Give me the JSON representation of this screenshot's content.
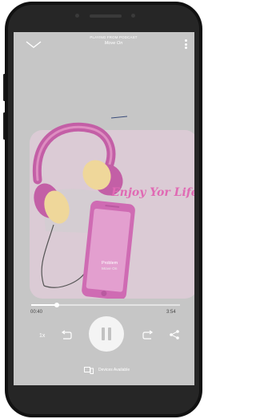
{
  "player": {
    "header_label": "PLAYING FROM PODCAST",
    "header_title": "Move On",
    "brand_text": "Enjoy Yor Life",
    "episode_title": "Problem",
    "episode_subtitle": "Move On",
    "elapsed": "00:40",
    "duration": "3:54",
    "progress": 0.17,
    "speed_label": "1x",
    "devices_label": "Devices Available"
  },
  "colors": {
    "screen_bg": "#c6c6c6",
    "accent_pink": "#e06ab4",
    "headphone_yellow": "#efd79a",
    "headphone_pink": "#c35fa6"
  },
  "icons": [
    "chevron-down-icon",
    "more-vertical-icon",
    "replay-icon",
    "pause-icon",
    "forward-icon",
    "share-icon",
    "devices-icon"
  ]
}
